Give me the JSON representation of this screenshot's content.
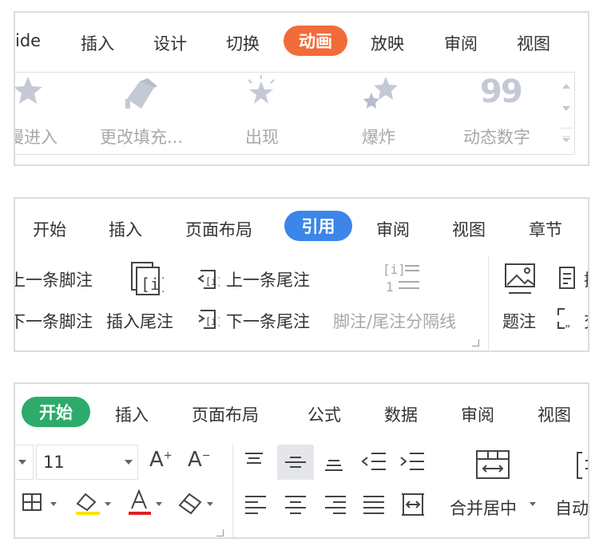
{
  "panel1": {
    "tabs": [
      "ide",
      "插入",
      "设计",
      "切换",
      "动画",
      "放映",
      "审阅",
      "视图"
    ],
    "active_tab": "动画",
    "active_color": "#f26b3a",
    "gallery": [
      "慢进入",
      "更改填充...",
      "出现",
      "爆炸",
      "动态数字"
    ],
    "gallery_icons": [
      "star-icon",
      "paint-bucket-icon",
      "burst-star-icon",
      "explode-stars-icon",
      "number-99-icon"
    ],
    "digit_text": "99"
  },
  "panel2": {
    "tabs": [
      "开始",
      "插入",
      "页面布局",
      "引用",
      "审阅",
      "视图",
      "章节"
    ],
    "active_tab": "引用",
    "active_color": "#3b86e8",
    "prev_footnote": "上一条脚注",
    "next_footnote": "下一条脚注",
    "insert_endnote": "插入尾注",
    "prev_endnote": "上一条尾注",
    "next_endnote": "下一条尾注",
    "separator": "脚注/尾注分隔线",
    "caption": "题注",
    "cut_text_1": "插",
    "cut_text_2": "交"
  },
  "panel3": {
    "tabs": [
      "开始",
      "插入",
      "页面布局",
      "公式",
      "数据",
      "审阅",
      "视图"
    ],
    "active_tab": "开始",
    "active_color": "#2dab6a",
    "font_size": "11",
    "merge_center": "合并居中",
    "auto_wrap": "自动",
    "highlight_color": "#f5e400",
    "font_color": "#e02020"
  }
}
